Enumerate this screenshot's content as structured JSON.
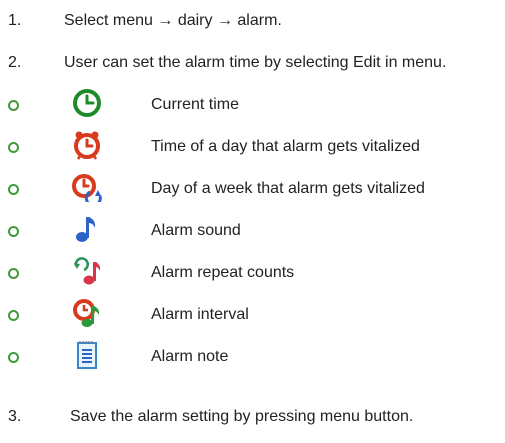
{
  "steps": {
    "s1": {
      "num": "1.",
      "text": "Select menu → dairy  → alarm."
    },
    "s2": {
      "num": "2.",
      "text": "User can set the alarm time by selecting Edit in menu."
    },
    "s3": {
      "num": "3.",
      "text": "Save the alarm setting by pressing menu button."
    }
  },
  "items": [
    {
      "icon": "clock-icon",
      "label": "Current time"
    },
    {
      "icon": "alarm-clock-icon",
      "label": "Time of a day that alarm gets vitalized"
    },
    {
      "icon": "weekly-clock-icon",
      "label": "Day of a week that alarm gets vitalized"
    },
    {
      "icon": "music-note-icon",
      "label": "Alarm sound"
    },
    {
      "icon": "repeat-note-icon",
      "label": "Alarm repeat counts"
    },
    {
      "icon": "interval-note-icon",
      "label": "Alarm interval"
    },
    {
      "icon": "notepad-icon",
      "label": "Alarm note"
    }
  ],
  "colors": {
    "bullet": "#3f9a3a",
    "text": "#222222"
  }
}
